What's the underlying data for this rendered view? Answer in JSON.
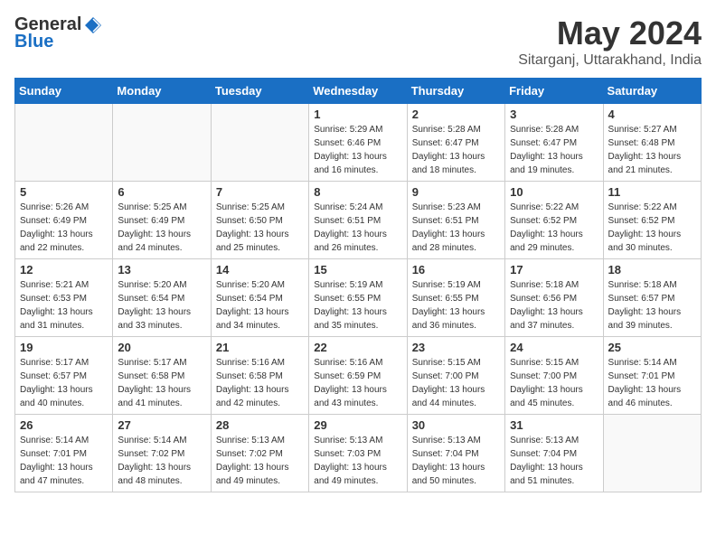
{
  "header": {
    "logo_general": "General",
    "logo_blue": "Blue",
    "month_year": "May 2024",
    "location": "Sitarganj, Uttarakhand, India"
  },
  "weekdays": [
    "Sunday",
    "Monday",
    "Tuesday",
    "Wednesday",
    "Thursday",
    "Friday",
    "Saturday"
  ],
  "weeks": [
    [
      {
        "day": "",
        "info": ""
      },
      {
        "day": "",
        "info": ""
      },
      {
        "day": "",
        "info": ""
      },
      {
        "day": "1",
        "info": "Sunrise: 5:29 AM\nSunset: 6:46 PM\nDaylight: 13 hours\nand 16 minutes."
      },
      {
        "day": "2",
        "info": "Sunrise: 5:28 AM\nSunset: 6:47 PM\nDaylight: 13 hours\nand 18 minutes."
      },
      {
        "day": "3",
        "info": "Sunrise: 5:28 AM\nSunset: 6:47 PM\nDaylight: 13 hours\nand 19 minutes."
      },
      {
        "day": "4",
        "info": "Sunrise: 5:27 AM\nSunset: 6:48 PM\nDaylight: 13 hours\nand 21 minutes."
      }
    ],
    [
      {
        "day": "5",
        "info": "Sunrise: 5:26 AM\nSunset: 6:49 PM\nDaylight: 13 hours\nand 22 minutes."
      },
      {
        "day": "6",
        "info": "Sunrise: 5:25 AM\nSunset: 6:49 PM\nDaylight: 13 hours\nand 24 minutes."
      },
      {
        "day": "7",
        "info": "Sunrise: 5:25 AM\nSunset: 6:50 PM\nDaylight: 13 hours\nand 25 minutes."
      },
      {
        "day": "8",
        "info": "Sunrise: 5:24 AM\nSunset: 6:51 PM\nDaylight: 13 hours\nand 26 minutes."
      },
      {
        "day": "9",
        "info": "Sunrise: 5:23 AM\nSunset: 6:51 PM\nDaylight: 13 hours\nand 28 minutes."
      },
      {
        "day": "10",
        "info": "Sunrise: 5:22 AM\nSunset: 6:52 PM\nDaylight: 13 hours\nand 29 minutes."
      },
      {
        "day": "11",
        "info": "Sunrise: 5:22 AM\nSunset: 6:52 PM\nDaylight: 13 hours\nand 30 minutes."
      }
    ],
    [
      {
        "day": "12",
        "info": "Sunrise: 5:21 AM\nSunset: 6:53 PM\nDaylight: 13 hours\nand 31 minutes."
      },
      {
        "day": "13",
        "info": "Sunrise: 5:20 AM\nSunset: 6:54 PM\nDaylight: 13 hours\nand 33 minutes."
      },
      {
        "day": "14",
        "info": "Sunrise: 5:20 AM\nSunset: 6:54 PM\nDaylight: 13 hours\nand 34 minutes."
      },
      {
        "day": "15",
        "info": "Sunrise: 5:19 AM\nSunset: 6:55 PM\nDaylight: 13 hours\nand 35 minutes."
      },
      {
        "day": "16",
        "info": "Sunrise: 5:19 AM\nSunset: 6:55 PM\nDaylight: 13 hours\nand 36 minutes."
      },
      {
        "day": "17",
        "info": "Sunrise: 5:18 AM\nSunset: 6:56 PM\nDaylight: 13 hours\nand 37 minutes."
      },
      {
        "day": "18",
        "info": "Sunrise: 5:18 AM\nSunset: 6:57 PM\nDaylight: 13 hours\nand 39 minutes."
      }
    ],
    [
      {
        "day": "19",
        "info": "Sunrise: 5:17 AM\nSunset: 6:57 PM\nDaylight: 13 hours\nand 40 minutes."
      },
      {
        "day": "20",
        "info": "Sunrise: 5:17 AM\nSunset: 6:58 PM\nDaylight: 13 hours\nand 41 minutes."
      },
      {
        "day": "21",
        "info": "Sunrise: 5:16 AM\nSunset: 6:58 PM\nDaylight: 13 hours\nand 42 minutes."
      },
      {
        "day": "22",
        "info": "Sunrise: 5:16 AM\nSunset: 6:59 PM\nDaylight: 13 hours\nand 43 minutes."
      },
      {
        "day": "23",
        "info": "Sunrise: 5:15 AM\nSunset: 7:00 PM\nDaylight: 13 hours\nand 44 minutes."
      },
      {
        "day": "24",
        "info": "Sunrise: 5:15 AM\nSunset: 7:00 PM\nDaylight: 13 hours\nand 45 minutes."
      },
      {
        "day": "25",
        "info": "Sunrise: 5:14 AM\nSunset: 7:01 PM\nDaylight: 13 hours\nand 46 minutes."
      }
    ],
    [
      {
        "day": "26",
        "info": "Sunrise: 5:14 AM\nSunset: 7:01 PM\nDaylight: 13 hours\nand 47 minutes."
      },
      {
        "day": "27",
        "info": "Sunrise: 5:14 AM\nSunset: 7:02 PM\nDaylight: 13 hours\nand 48 minutes."
      },
      {
        "day": "28",
        "info": "Sunrise: 5:13 AM\nSunset: 7:02 PM\nDaylight: 13 hours\nand 49 minutes."
      },
      {
        "day": "29",
        "info": "Sunrise: 5:13 AM\nSunset: 7:03 PM\nDaylight: 13 hours\nand 49 minutes."
      },
      {
        "day": "30",
        "info": "Sunrise: 5:13 AM\nSunset: 7:04 PM\nDaylight: 13 hours\nand 50 minutes."
      },
      {
        "day": "31",
        "info": "Sunrise: 5:13 AM\nSunset: 7:04 PM\nDaylight: 13 hours\nand 51 minutes."
      },
      {
        "day": "",
        "info": ""
      }
    ]
  ]
}
